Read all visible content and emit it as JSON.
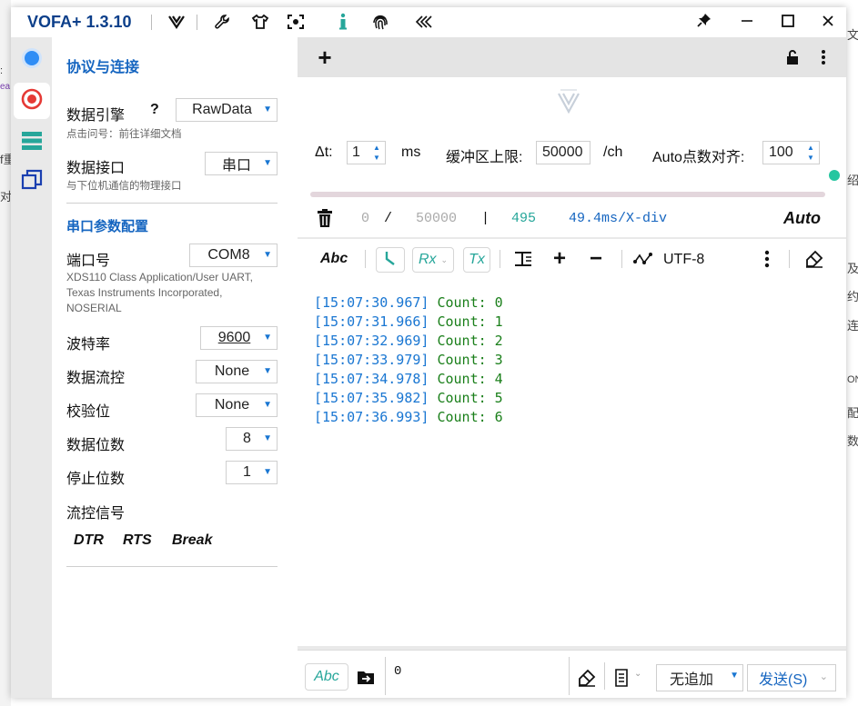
{
  "background": {
    "left_fragments": [
      ":",
      "ea",
      "f重",
      "对"
    ],
    "right_fragments": [
      "文",
      "绍",
      "及",
      "约",
      "连",
      "ON",
      "配",
      "数"
    ]
  },
  "titlebar": {
    "app_title": "VOFA+ 1.3.10",
    "window_controls": [
      "pin-icon",
      "minimize-icon",
      "maximize-icon",
      "close-icon"
    ]
  },
  "rail": {
    "items": [
      "connection-icon",
      "record-icon",
      "list-icon",
      "window-copy-icon"
    ]
  },
  "config": {
    "section_protocol": "协议与连接",
    "engine_label": "数据引擎",
    "engine_help": "?",
    "engine_value": "RawData",
    "engine_hint": "点击问号：前往详细文档",
    "interface_label": "数据接口",
    "interface_value": "串口",
    "interface_hint": "与下位机通信的物理接口",
    "section_serial": "串口参数配置",
    "port_label": "端口号",
    "port_value": "COM8",
    "port_desc": "XDS110 Class Application/User UART, Texas Instruments Incorporated, NOSERIAL",
    "baud_label": "波特率",
    "baud_value": "9600",
    "flow_label": "数据流控",
    "flow_value": "None",
    "parity_label": "校验位",
    "parity_value": "None",
    "databits_label": "数据位数",
    "databits_value": "8",
    "stopbits_label": "停止位数",
    "stopbits_value": "1",
    "flowsig_label": "流控信号",
    "flowsig_buttons": [
      "DTR",
      "RTS",
      "Break"
    ]
  },
  "main": {
    "add_label": "+",
    "controls": {
      "dt_label": "Δt:",
      "dt_value": "1",
      "dt_unit": "ms",
      "buffer_label": "缓冲区上限:",
      "buffer_value": "50000",
      "buffer_unit": "/ch",
      "align_label": "Auto点数对齐:",
      "align_value": "100"
    },
    "stats": {
      "count_current": "0",
      "slash": "/",
      "count_total": "50000",
      "bar": "|",
      "points": "495",
      "per_div": "49.4ms/X-div",
      "mode": "Auto"
    },
    "rx_toolbar": {
      "abc": "Abc",
      "rx": "Rx",
      "tx": "Tx",
      "plus": "+",
      "minus": "−",
      "encoding": "UTF-8"
    },
    "log_lines": [
      {
        "ts": "[15:07:30.967]",
        "text": " Count: 0"
      },
      {
        "ts": "[15:07:31.966]",
        "text": " Count: 1"
      },
      {
        "ts": "[15:07:32.969]",
        "text": " Count: 2"
      },
      {
        "ts": "[15:07:33.979]",
        "text": " Count: 3"
      },
      {
        "ts": "[15:07:34.978]",
        "text": " Count: 4"
      },
      {
        "ts": "[15:07:35.982]",
        "text": " Count: 5"
      },
      {
        "ts": "[15:07:36.993]",
        "text": " Count: 6"
      }
    ],
    "send_bar": {
      "abc": "Abc",
      "input_value": "0",
      "append_value": "无追加",
      "send_label": "发送(S)"
    },
    "colors": {
      "accent": "#1976d2",
      "teal": "#26a69a",
      "timestamp": "#1976d2",
      "text_green": "#1a7f1a"
    }
  }
}
